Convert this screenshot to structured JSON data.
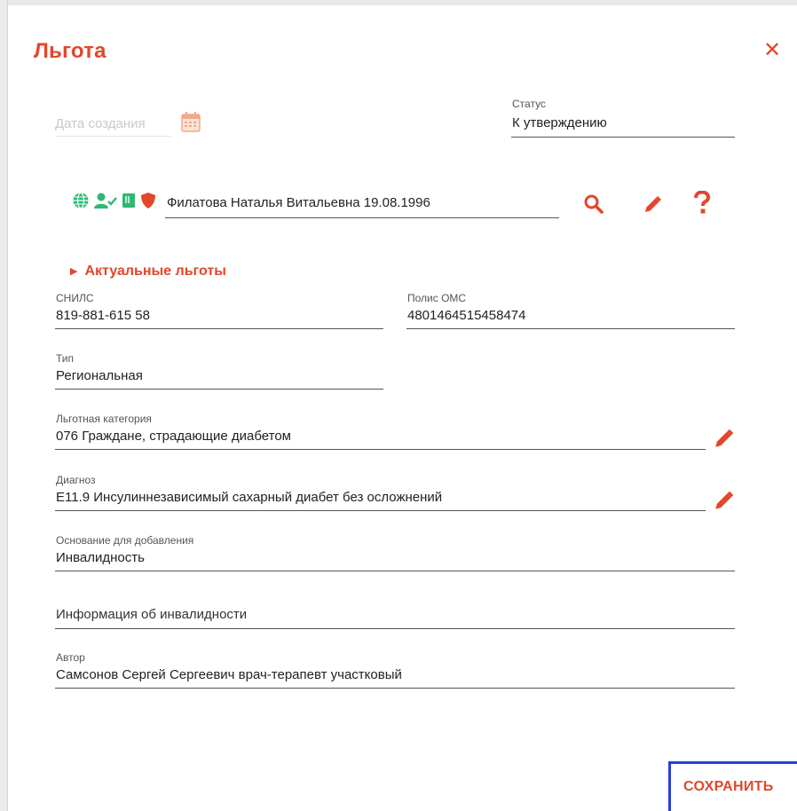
{
  "dialog": {
    "title": "Льгота",
    "close_glyph": "✕"
  },
  "created_date": {
    "placeholder": "Дата создания"
  },
  "status": {
    "label": "Статус",
    "value": "К утверждению"
  },
  "patient": {
    "icons": [
      "globe-icon",
      "user-check-icon",
      "card-icon",
      "shield-icon"
    ],
    "value": "Филатова Наталья Витальевна 19.08.1996",
    "actions": [
      "search-icon",
      "pencil-icon",
      "question-icon"
    ]
  },
  "actual_benefits": {
    "label": "Актуальные льготы"
  },
  "snils": {
    "label": "СНИЛС",
    "value": "819-881-615 58"
  },
  "oms": {
    "label": "Полис ОМС",
    "value": "4801464515458474"
  },
  "type": {
    "label": "Тип",
    "value": "Региональная"
  },
  "category": {
    "label": "Льготная категория",
    "value": "076 Граждане, страдающие диабетом"
  },
  "diagnosis": {
    "label": "Диагноз",
    "value": "E11.9 Инсулиннезависимый сахарный диабет без осложнений"
  },
  "basis": {
    "label": "Основание для добавления",
    "value": "Инвалидность"
  },
  "disability_info": {
    "placeholder": "Информация об инвалидности"
  },
  "author": {
    "label": "Автор",
    "value": "Самсонов Сергей Сергеевич врач-терапевт участковый"
  },
  "footer": {
    "save_label": "СОХРАНИТЬ"
  },
  "colors": {
    "accent": "#e2472b",
    "green": "#2eb872",
    "focus_border": "#2a3de0"
  }
}
